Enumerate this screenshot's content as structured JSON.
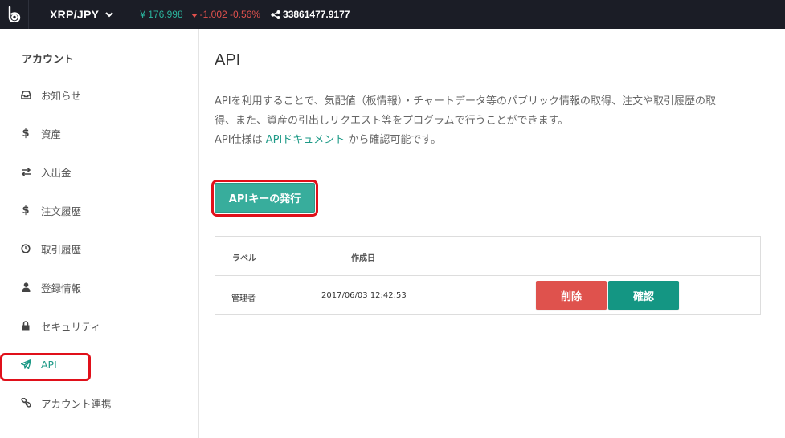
{
  "topbar": {
    "pair": "XRP/JPY",
    "price": "¥ 176.998",
    "change": "-1.002 -0.56%",
    "volume": "33861477.9177"
  },
  "sidebar": {
    "title": "アカウント",
    "items": [
      {
        "label": "お知らせ",
        "icon": "inbox-icon"
      },
      {
        "label": "資産",
        "icon": "dollar-icon"
      },
      {
        "label": "入出金",
        "icon": "exchange-arrows-icon"
      },
      {
        "label": "注文履歴",
        "icon": "dollar-icon"
      },
      {
        "label": "取引履歴",
        "icon": "clock-icon"
      },
      {
        "label": "登録情報",
        "icon": "user-icon"
      },
      {
        "label": "セキュリティ",
        "icon": "lock-icon"
      },
      {
        "label": "API",
        "icon": "paper-plane-icon",
        "active": true
      },
      {
        "label": "アカウント連携",
        "icon": "link-icon"
      }
    ]
  },
  "main": {
    "title": "API",
    "desc_line1": "APIを利用することで、気配値（板情報）・チャートデータ等のパブリック情報の取得、注文や取引履歴の取",
    "desc_line2": "得、また、資産の引出しリクエスト等をプログラムで行うことができます。",
    "desc_line3_prefix": "API仕様は ",
    "desc_link": "APIドキュメント",
    "desc_line3_suffix": " から確認可能です。",
    "issue_button": "APIキーの発行",
    "table": {
      "headers": [
        "ラベル",
        "作成日"
      ],
      "rows": [
        {
          "label": "管理者",
          "created": "2017/06/03 12:42:53",
          "delete": "削除",
          "confirm": "確認"
        }
      ]
    }
  },
  "colors": {
    "accent": "#1e9a87",
    "topbar": "#1b1d26",
    "up": "#2bb59e",
    "down": "#e2514d",
    "highlight": "#e0101a"
  }
}
